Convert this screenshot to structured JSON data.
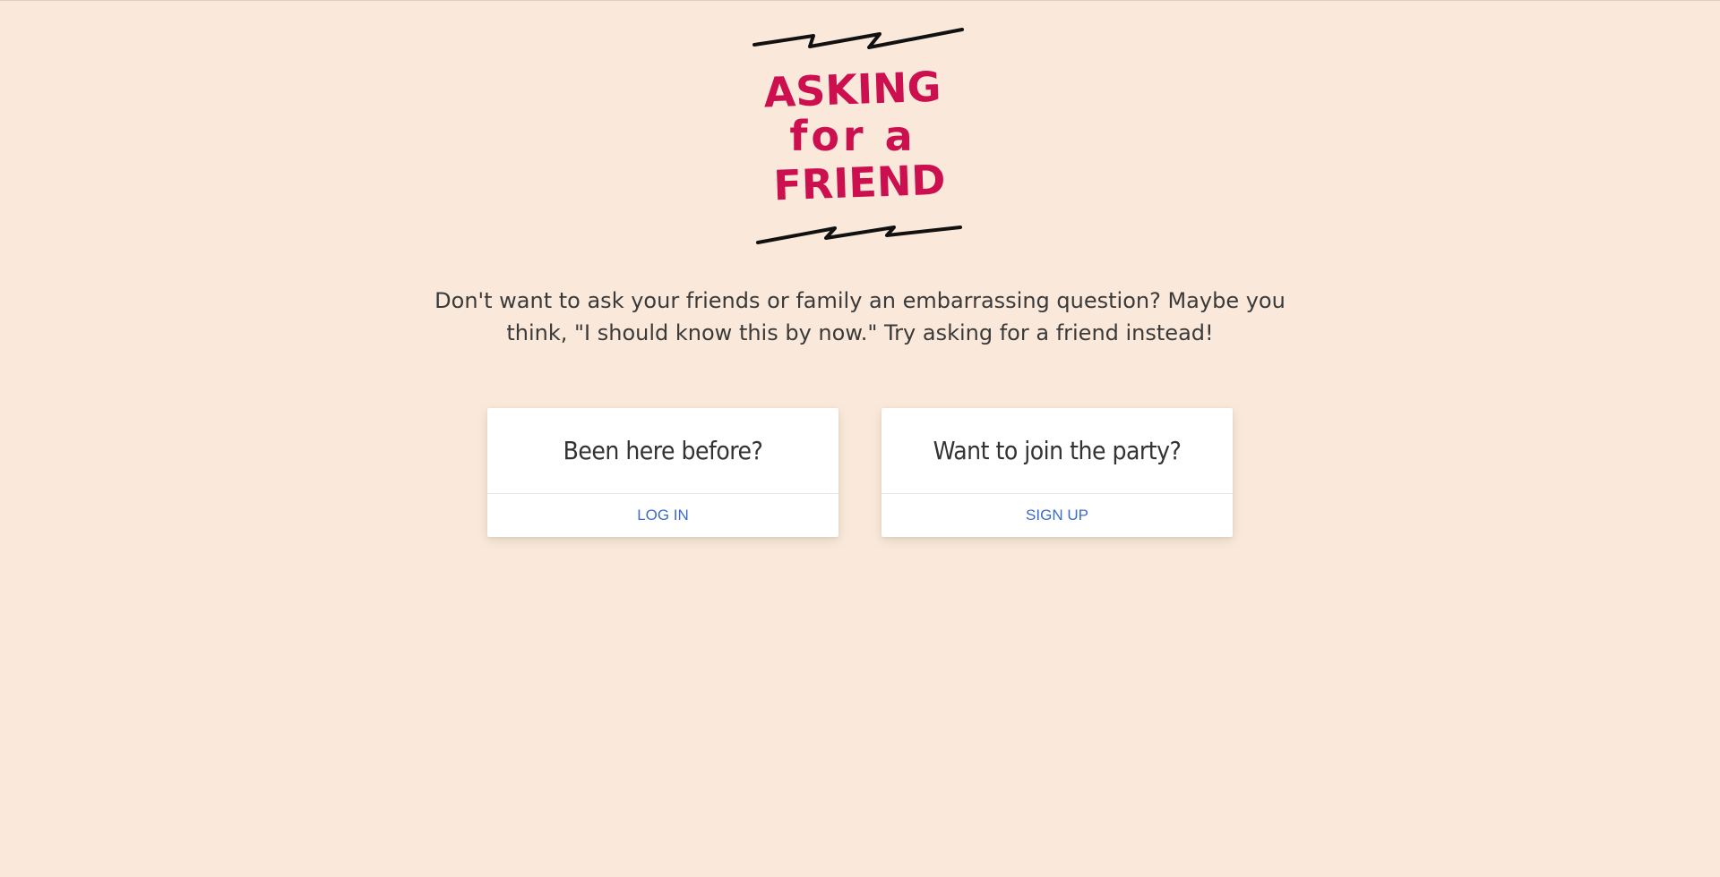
{
  "logo": {
    "line1": "ASKING",
    "line2": "for a",
    "line3": "FRIEND",
    "text_color": "#cc0f4f"
  },
  "tagline": "Don't want to ask your friends or family an embarrassing question? Maybe you think, \"I should know this by now.\" Try asking for a friend instead!",
  "cards": {
    "login": {
      "title": "Been here before?",
      "action": "LOG IN"
    },
    "signup": {
      "title": "Want to join the party?",
      "action": "SIGN UP"
    }
  },
  "colors": {
    "background": "#fae9da",
    "link": "#3b6cc9",
    "logo": "#cc0f4f"
  }
}
